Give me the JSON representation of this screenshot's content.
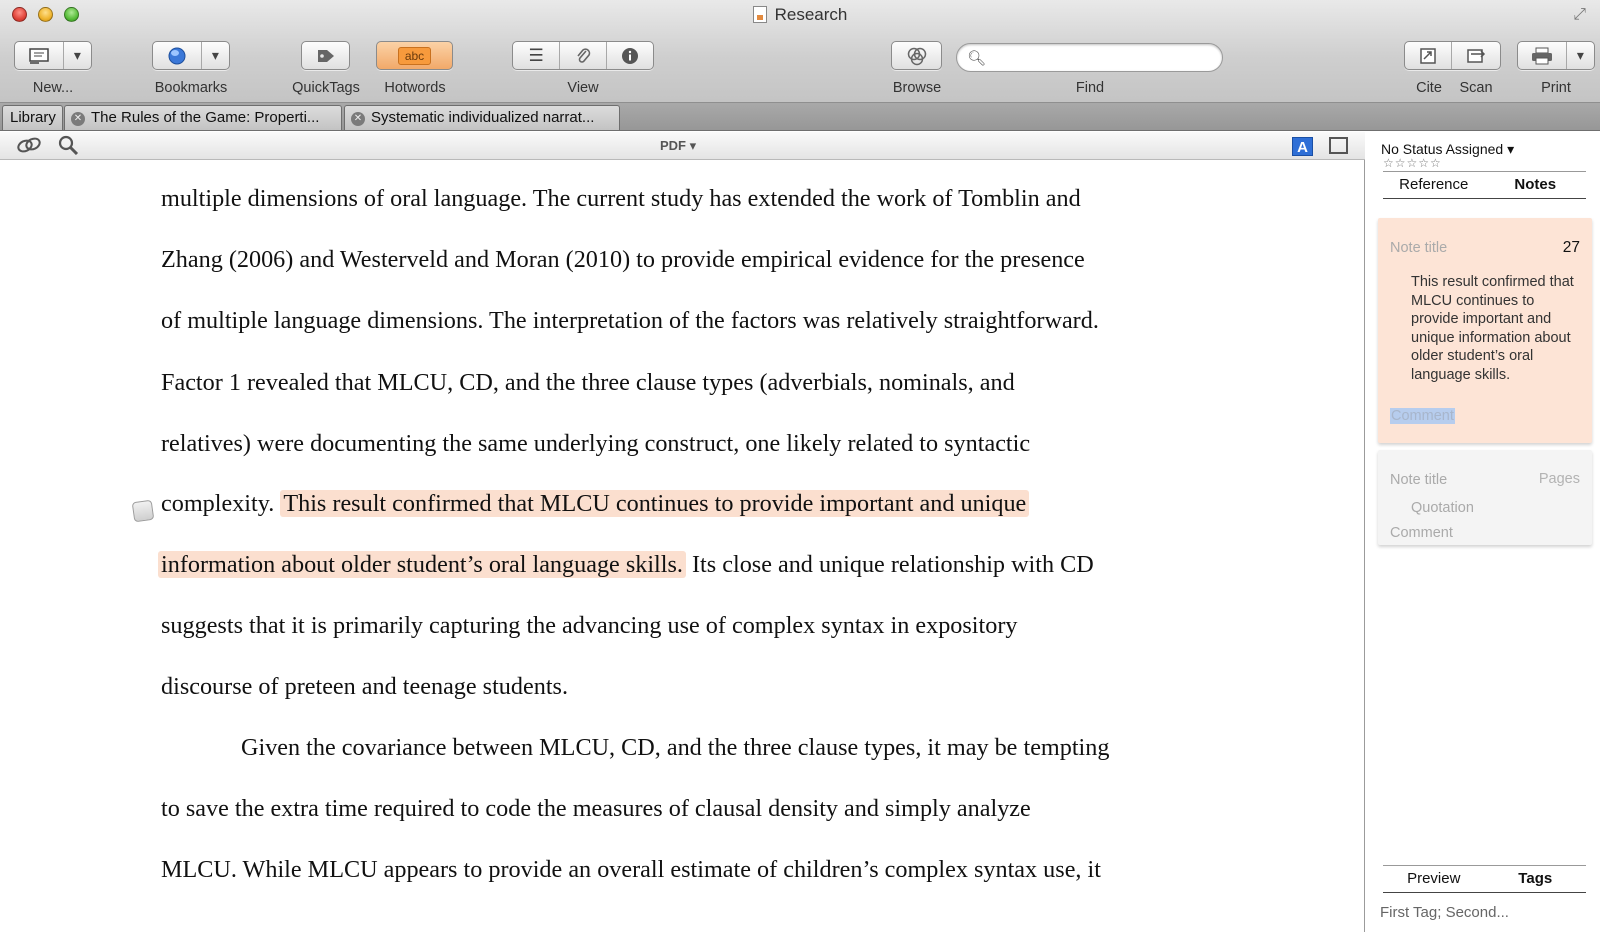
{
  "window": {
    "title": "Research"
  },
  "toolbar": {
    "new_label": "New...",
    "bookmarks_label": "Bookmarks",
    "quicktags_label": "QuickTags",
    "hotwords_label": "Hotwords",
    "hotwords_button_text": "abc",
    "view_label": "View",
    "browse_label": "Browse",
    "find_label": "Find",
    "find_placeholder": "",
    "cite_label": "Cite",
    "scan_label": "Scan",
    "print_label": "Print"
  },
  "tabs": [
    {
      "label": "Library"
    },
    {
      "label": "The Rules of the Game: Properti..."
    },
    {
      "label": "Systematic individualized narrat..."
    }
  ],
  "pdfbar": {
    "mode": "PDF ▾",
    "font_button": "A"
  },
  "document": {
    "lines": [
      "multiple dimensions of oral language. The current study has extended the work of Tomblin and",
      "Zhang (2006) and Westerveld and Moran (2010) to provide empirical evidence for the presence",
      "of multiple language dimensions. The interpretation of the factors was relatively straightforward.",
      "Factor 1 revealed that MLCU, CD, and the three clause types (adverbials, nominals, and",
      "relatives) were documenting the same underlying construct, one likely related to syntactic"
    ],
    "line6_pre": "complexity. ",
    "line6_hl": "This result confirmed that MLCU continues to provide important and unique",
    "line7_hl": "information about older student’s oral language skills.",
    "line7_post": " Its close and unique relationship with CD",
    "lines_after": [
      "suggests that it is primarily capturing the advancing use of complex syntax in expository",
      "discourse of preteen and teenage students.",
      "Given the covariance between MLCU, CD, and the three clause types, it may be tempting",
      "to save the extra time required to code the measures of clausal density and simply analyze",
      "MLCU. While MLCU appears to provide an overall estimate of children’s complex syntax use, it"
    ]
  },
  "panel": {
    "status": "No Status Assigned ▾",
    "stars": "☆☆☆☆☆",
    "tab_reference": "Reference",
    "tab_notes": "Notes",
    "note1": {
      "title_placeholder": "Note title",
      "pages": "27",
      "quotation": "This result confirmed that MLCU continues to provide important and unique information about older student’s oral language skills.",
      "comment_placeholder": "Comment"
    },
    "note2": {
      "title_placeholder": "Note title",
      "pages_placeholder": "Pages",
      "quotation_placeholder": "Quotation",
      "comment_placeholder": "Comment"
    },
    "tab_preview": "Preview",
    "tab_tags": "Tags",
    "tags_placeholder": "First Tag; Second..."
  },
  "colors": {
    "highlight": "#fbdfcf",
    "note_card": "#fde4d6",
    "hotwords": "#f79a3c",
    "accent_blue": "#2f6fd6"
  }
}
